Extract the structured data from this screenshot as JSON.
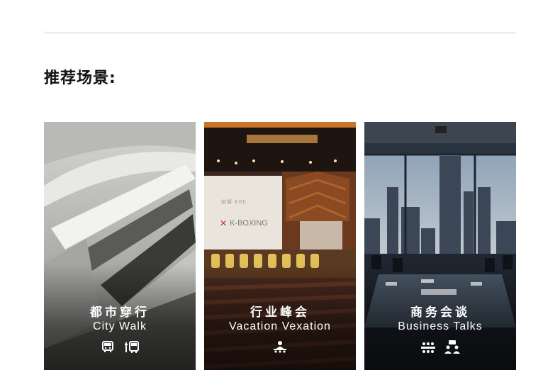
{
  "section": {
    "heading": "推荐场景:"
  },
  "cards": [
    {
      "title_zh": "都市穿行",
      "title_en": "City Walk",
      "icons": [
        "bus-icon",
        "transit-icon"
      ]
    },
    {
      "title_zh": "行业峰会",
      "title_en": "Vacation Vexation",
      "screen_brand": "K-BOXING",
      "screen_top": "刻挚 K00",
      "icons": [
        "presenter-icon"
      ]
    },
    {
      "title_zh": "商务会谈",
      "title_en": "Business Talks",
      "icons": [
        "meeting-table-icon",
        "discussion-icon"
      ]
    }
  ]
}
